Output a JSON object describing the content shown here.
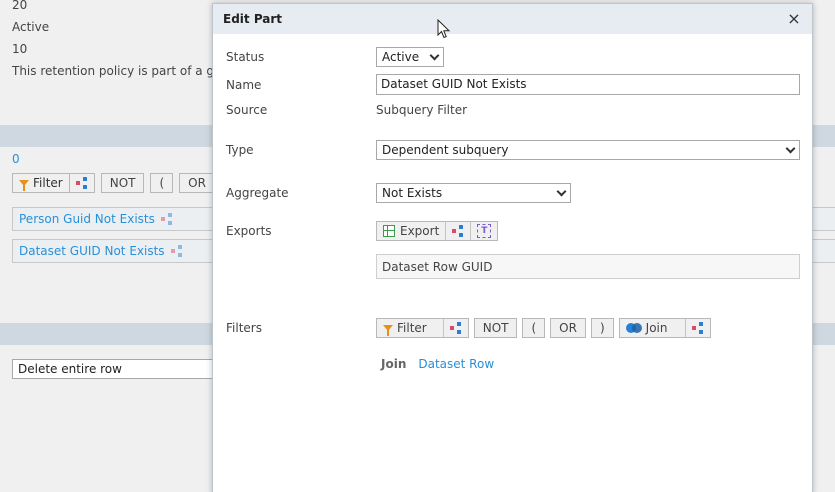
{
  "background": {
    "lines": [
      "20",
      "Active",
      "10",
      "This retention policy is part of a group"
    ],
    "count_link": "0",
    "toolbar": {
      "filter": "Filter",
      "not": "NOT",
      "paren_open": "(",
      "or_partial": "OR"
    },
    "chips": [
      "Person Guid Not Exists",
      "Dataset GUID Not Exists"
    ],
    "action_select": "Delete entire row"
  },
  "modal": {
    "title": "Edit Part",
    "close_glyph": "×",
    "labels": {
      "status": "Status",
      "name": "Name",
      "source": "Source",
      "type": "Type",
      "aggregate": "Aggregate",
      "exports": "Exports",
      "filters": "Filters"
    },
    "status_value": "Active",
    "name_value": "Dataset GUID Not Exists",
    "source_value": "Subquery Filter",
    "type_value": "Dependent subquery",
    "aggregate_value": "Not Exists",
    "exports": {
      "button": "Export",
      "field": "Dataset Row GUID"
    },
    "filters": {
      "filter_button": "Filter",
      "not": "NOT",
      "paren_open": "(",
      "or": "OR",
      "paren_close": ")",
      "join_button": "Join"
    },
    "join": {
      "label": "Join",
      "link": "Dataset Row"
    }
  },
  "colors": {
    "accent": "#2a8fd8",
    "header": "#e6ecf1",
    "band": "#cfd8e0"
  }
}
